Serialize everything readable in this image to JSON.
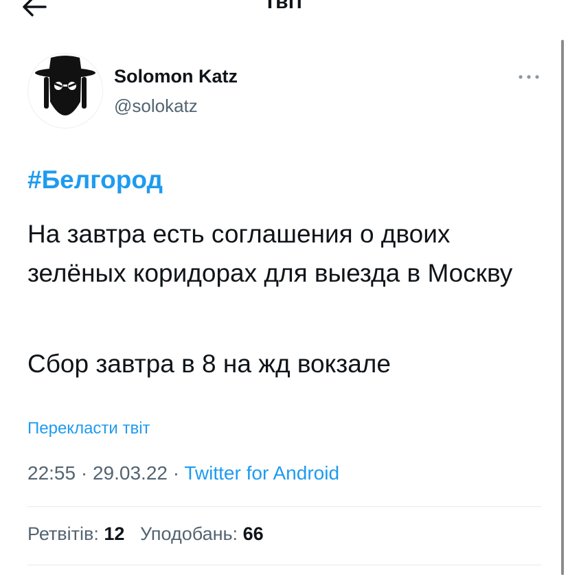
{
  "header": {
    "title": "Твіт",
    "back_icon": "arrow-left-icon"
  },
  "tweet": {
    "author_name": "Solomon Katz",
    "author_handle": "@solokatz",
    "avatar_icon": "hasidic-man-avatar",
    "more_icon": "more-dots-icon",
    "hashtag": "#Белгород",
    "paragraph1": "На завтра есть соглашения о двоих зелёных коридорах для выезда в Москву",
    "paragraph2": "Сбор завтра в 8 на жд вокзале",
    "translate_label": "Перекласти твіт",
    "time": "22:55",
    "date": "29.03.22",
    "separator": " · ",
    "source": "Twitter for Android",
    "retweets_label": "Ретвітів:",
    "retweets_count": "12",
    "likes_label": "Уподобань:",
    "likes_count": "66"
  },
  "colors": {
    "accent": "#1d9bf0",
    "text_primary": "#0f1419",
    "text_secondary": "#536471",
    "divider": "#e6e9eb"
  }
}
